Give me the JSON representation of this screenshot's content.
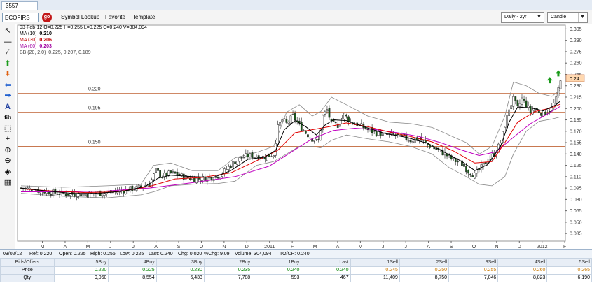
{
  "window": {
    "tab_label": "3557  ECOFIRS"
  },
  "toolbar": {
    "symbol_value": "ECOFIRS",
    "go_label": "go",
    "symbol_lookup": "Symbol Lookup",
    "favorite": "Favorite",
    "template": "Template",
    "period_select": "Daily - 2yr",
    "chart_type_select": "Candle"
  },
  "tools": [
    {
      "name": "cursor-icon",
      "glyph": "↖"
    },
    {
      "name": "horizontal-line-icon",
      "glyph": "—"
    },
    {
      "name": "trend-line-icon",
      "glyph": "∕"
    },
    {
      "name": "buy-arrow-icon",
      "glyph": "⬆"
    },
    {
      "name": "sell-arrow-icon",
      "glyph": "⬇"
    },
    {
      "name": "left-arrow-icon",
      "glyph": "⬅"
    },
    {
      "name": "right-arrow-icon",
      "glyph": "➡"
    },
    {
      "name": "text-tool-icon",
      "glyph": "A"
    },
    {
      "name": "fibonacci-icon",
      "glyph": "fib"
    },
    {
      "name": "select-region-icon",
      "glyph": "⬚"
    },
    {
      "name": "crosshair-icon",
      "glyph": "+"
    },
    {
      "name": "zoom-in-icon",
      "glyph": "⊕"
    },
    {
      "name": "zoom-out-icon",
      "glyph": "⊖"
    },
    {
      "name": "pan-icon",
      "glyph": "◈"
    },
    {
      "name": "grid-icon",
      "glyph": "▦"
    }
  ],
  "chart_header": {
    "ohlcv": "03-Feb-12  O=0.225  H=0.255  L=0.225  C=0.240  V=304,094",
    "ma1_label": "MA (10)",
    "ma1_value": "0.210",
    "ma2_label": "MA (30)",
    "ma2_value": "0.206",
    "ma3_label": "MA (60)",
    "ma3_value": "0.203",
    "bb_label": "BB (20, 2.0)",
    "bb_value": "0.225, 0.207, 0.189"
  },
  "colors": {
    "ma10": "#000000",
    "ma30": "#e00000",
    "ma60": "#c000c0",
    "bb": "#888888",
    "up": "#ffffff",
    "down": "#1a5a1a",
    "hline": "#c87850",
    "price_marker": "#ffd8b0"
  },
  "chart_data": {
    "type": "candlestick",
    "x_tick_labels": [
      "M",
      "A",
      "M",
      "J",
      "J",
      "A",
      "S",
      "O",
      "N",
      "D",
      "2011",
      "F",
      "M",
      "A",
      "M",
      "J",
      "J",
      "A",
      "S",
      "O",
      "N",
      "D",
      "2012",
      "F"
    ],
    "y_ticks": [
      "0.305",
      "0.290",
      "0.275",
      "0.260",
      "0.245",
      "0.230",
      "0.215",
      "0.200",
      "0.185",
      "0.170",
      "0.155",
      "0.140",
      "0.125",
      "0.110",
      "0.095",
      "0.080",
      "0.065",
      "0.050",
      "0.035"
    ],
    "ylim": [
      0.025,
      0.31
    ],
    "last_price_marker": "0.24",
    "horizontal_lines": [
      {
        "value": 0.22,
        "label": "0.220"
      },
      {
        "value": 0.195,
        "label": "0.195"
      },
      {
        "value": 0.15,
        "label": "0.150"
      }
    ],
    "close_path": [
      [
        0,
        0.095
      ],
      [
        6,
        0.093
      ],
      [
        12,
        0.09
      ],
      [
        18,
        0.088
      ],
      [
        24,
        0.087
      ],
      [
        30,
        0.087
      ],
      [
        36,
        0.088
      ],
      [
        42,
        0.089
      ],
      [
        48,
        0.092
      ],
      [
        54,
        0.095
      ],
      [
        60,
        0.1
      ],
      [
        63,
        0.118
      ],
      [
        66,
        0.11
      ],
      [
        70,
        0.115
      ],
      [
        74,
        0.112
      ],
      [
        78,
        0.108
      ],
      [
        82,
        0.107
      ],
      [
        86,
        0.108
      ],
      [
        90,
        0.11
      ],
      [
        93,
        0.112
      ],
      [
        96,
        0.12
      ],
      [
        100,
        0.13
      ],
      [
        103,
        0.135
      ],
      [
        106,
        0.138
      ],
      [
        110,
        0.137
      ],
      [
        114,
        0.136
      ],
      [
        118,
        0.14
      ],
      [
        120,
        0.175
      ],
      [
        122,
        0.185
      ],
      [
        124,
        0.18
      ],
      [
        127,
        0.19
      ],
      [
        130,
        0.178
      ],
      [
        133,
        0.168
      ],
      [
        136,
        0.16
      ],
      [
        139,
        0.157
      ],
      [
        141,
        0.19
      ],
      [
        143,
        0.198
      ],
      [
        145,
        0.18
      ],
      [
        148,
        0.178
      ],
      [
        151,
        0.192
      ],
      [
        154,
        0.182
      ],
      [
        158,
        0.178
      ],
      [
        162,
        0.172
      ],
      [
        166,
        0.168
      ],
      [
        170,
        0.165
      ],
      [
        174,
        0.165
      ],
      [
        178,
        0.163
      ],
      [
        182,
        0.158
      ],
      [
        186,
        0.16
      ],
      [
        190,
        0.152
      ],
      [
        194,
        0.146
      ],
      [
        198,
        0.14
      ],
      [
        202,
        0.132
      ],
      [
        206,
        0.127
      ],
      [
        209,
        0.117
      ],
      [
        212,
        0.112
      ],
      [
        215,
        0.122
      ],
      [
        218,
        0.132
      ],
      [
        221,
        0.14
      ],
      [
        224,
        0.155
      ],
      [
        226,
        0.178
      ],
      [
        228,
        0.2
      ],
      [
        230,
        0.212
      ],
      [
        232,
        0.2
      ],
      [
        234,
        0.213
      ],
      [
        236,
        0.205
      ],
      [
        238,
        0.195
      ],
      [
        240,
        0.2
      ],
      [
        242,
        0.196
      ],
      [
        244,
        0.193
      ],
      [
        246,
        0.197
      ],
      [
        248,
        0.2
      ],
      [
        250,
        0.212
      ],
      [
        252,
        0.24
      ]
    ],
    "ma10": [
      [
        0,
        0.095
      ],
      [
        12,
        0.091
      ],
      [
        24,
        0.088
      ],
      [
        36,
        0.088
      ],
      [
        48,
        0.091
      ],
      [
        58,
        0.097
      ],
      [
        64,
        0.108
      ],
      [
        70,
        0.112
      ],
      [
        80,
        0.11
      ],
      [
        90,
        0.109
      ],
      [
        98,
        0.118
      ],
      [
        106,
        0.133
      ],
      [
        114,
        0.136
      ],
      [
        119,
        0.145
      ],
      [
        123,
        0.172
      ],
      [
        128,
        0.184
      ],
      [
        133,
        0.176
      ],
      [
        138,
        0.165
      ],
      [
        142,
        0.178
      ],
      [
        146,
        0.185
      ],
      [
        152,
        0.184
      ],
      [
        160,
        0.176
      ],
      [
        170,
        0.167
      ],
      [
        180,
        0.162
      ],
      [
        190,
        0.154
      ],
      [
        198,
        0.142
      ],
      [
        206,
        0.13
      ],
      [
        212,
        0.118
      ],
      [
        218,
        0.126
      ],
      [
        224,
        0.15
      ],
      [
        228,
        0.182
      ],
      [
        232,
        0.202
      ],
      [
        238,
        0.201
      ],
      [
        244,
        0.197
      ],
      [
        250,
        0.205
      ],
      [
        252,
        0.21
      ]
    ],
    "ma30": [
      [
        0,
        0.094
      ],
      [
        15,
        0.091
      ],
      [
        30,
        0.089
      ],
      [
        45,
        0.09
      ],
      [
        60,
        0.097
      ],
      [
        72,
        0.107
      ],
      [
        85,
        0.109
      ],
      [
        98,
        0.115
      ],
      [
        110,
        0.131
      ],
      [
        120,
        0.145
      ],
      [
        128,
        0.168
      ],
      [
        136,
        0.172
      ],
      [
        144,
        0.176
      ],
      [
        152,
        0.181
      ],
      [
        162,
        0.176
      ],
      [
        172,
        0.169
      ],
      [
        182,
        0.163
      ],
      [
        192,
        0.156
      ],
      [
        202,
        0.144
      ],
      [
        212,
        0.128
      ],
      [
        220,
        0.13
      ],
      [
        226,
        0.155
      ],
      [
        232,
        0.182
      ],
      [
        240,
        0.196
      ],
      [
        248,
        0.201
      ],
      [
        252,
        0.206
      ]
    ],
    "ma60": [
      [
        0,
        0.09
      ],
      [
        20,
        0.09
      ],
      [
        40,
        0.091
      ],
      [
        60,
        0.095
      ],
      [
        80,
        0.102
      ],
      [
        100,
        0.11
      ],
      [
        116,
        0.124
      ],
      [
        126,
        0.142
      ],
      [
        136,
        0.16
      ],
      [
        146,
        0.171
      ],
      [
        156,
        0.174
      ],
      [
        166,
        0.172
      ],
      [
        176,
        0.168
      ],
      [
        186,
        0.163
      ],
      [
        196,
        0.155
      ],
      [
        206,
        0.145
      ],
      [
        214,
        0.138
      ],
      [
        222,
        0.143
      ],
      [
        230,
        0.162
      ],
      [
        238,
        0.18
      ],
      [
        246,
        0.193
      ],
      [
        252,
        0.203
      ]
    ],
    "bb_upper": [
      [
        0,
        0.098
      ],
      [
        20,
        0.096
      ],
      [
        40,
        0.098
      ],
      [
        56,
        0.1
      ],
      [
        62,
        0.125
      ],
      [
        70,
        0.128
      ],
      [
        80,
        0.118
      ],
      [
        92,
        0.118
      ],
      [
        100,
        0.135
      ],
      [
        110,
        0.142
      ],
      [
        118,
        0.15
      ],
      [
        124,
        0.195
      ],
      [
        130,
        0.205
      ],
      [
        136,
        0.19
      ],
      [
        140,
        0.196
      ],
      [
        145,
        0.215
      ],
      [
        152,
        0.205
      ],
      [
        162,
        0.19
      ],
      [
        172,
        0.182
      ],
      [
        182,
        0.18
      ],
      [
        192,
        0.175
      ],
      [
        200,
        0.165
      ],
      [
        208,
        0.155
      ],
      [
        214,
        0.14
      ],
      [
        220,
        0.15
      ],
      [
        226,
        0.19
      ],
      [
        230,
        0.235
      ],
      [
        236,
        0.23
      ],
      [
        242,
        0.22
      ],
      [
        248,
        0.216
      ],
      [
        252,
        0.225
      ]
    ],
    "bb_lower": [
      [
        0,
        0.088
      ],
      [
        20,
        0.084
      ],
      [
        40,
        0.082
      ],
      [
        56,
        0.086
      ],
      [
        62,
        0.09
      ],
      [
        70,
        0.098
      ],
      [
        80,
        0.1
      ],
      [
        92,
        0.101
      ],
      [
        100,
        0.104
      ],
      [
        110,
        0.125
      ],
      [
        118,
        0.13
      ],
      [
        124,
        0.14
      ],
      [
        130,
        0.15
      ],
      [
        136,
        0.15
      ],
      [
        140,
        0.148
      ],
      [
        145,
        0.158
      ],
      [
        152,
        0.165
      ],
      [
        162,
        0.16
      ],
      [
        172,
        0.156
      ],
      [
        182,
        0.15
      ],
      [
        192,
        0.14
      ],
      [
        200,
        0.122
      ],
      [
        208,
        0.11
      ],
      [
        214,
        0.1
      ],
      [
        220,
        0.098
      ],
      [
        226,
        0.11
      ],
      [
        230,
        0.14
      ],
      [
        236,
        0.17
      ],
      [
        242,
        0.183
      ],
      [
        248,
        0.186
      ],
      [
        252,
        0.189
      ]
    ],
    "buy_signals": [
      [
        247,
        0.237
      ],
      [
        251,
        0.246
      ]
    ]
  },
  "info_bar": {
    "date": "03/02/12",
    "ref": "Ref: 0.220",
    "open": "Open: 0.225",
    "high": "High: 0.255",
    "low": "Low: 0.225",
    "last": "Last: 0.240",
    "chg": "Chg: 0.020",
    "pchg": "%Chg: 9.09",
    "volume": "Volume: 304,094",
    "tocp": "TO/CP: 0.240"
  },
  "quotes": {
    "headers": [
      "Bids/Offers",
      "5Buy",
      "4Buy",
      "3Buy",
      "2Buy",
      "1Buy",
      "Last",
      "1Sell",
      "2Sell",
      "3Sell",
      "4Sell",
      "5Sell"
    ],
    "price": [
      "Price",
      "0.220",
      "0.225",
      "0.230",
      "0.235",
      "0.240",
      "0.240",
      "0.245",
      "0.250",
      "0.255",
      "0.260",
      "0.265"
    ],
    "qty": [
      "Qty",
      "9,060",
      "8,554",
      "6,433",
      "7,788",
      "593",
      "467",
      "11,409",
      "8,750",
      "7,046",
      "8,823",
      "6,190"
    ]
  }
}
